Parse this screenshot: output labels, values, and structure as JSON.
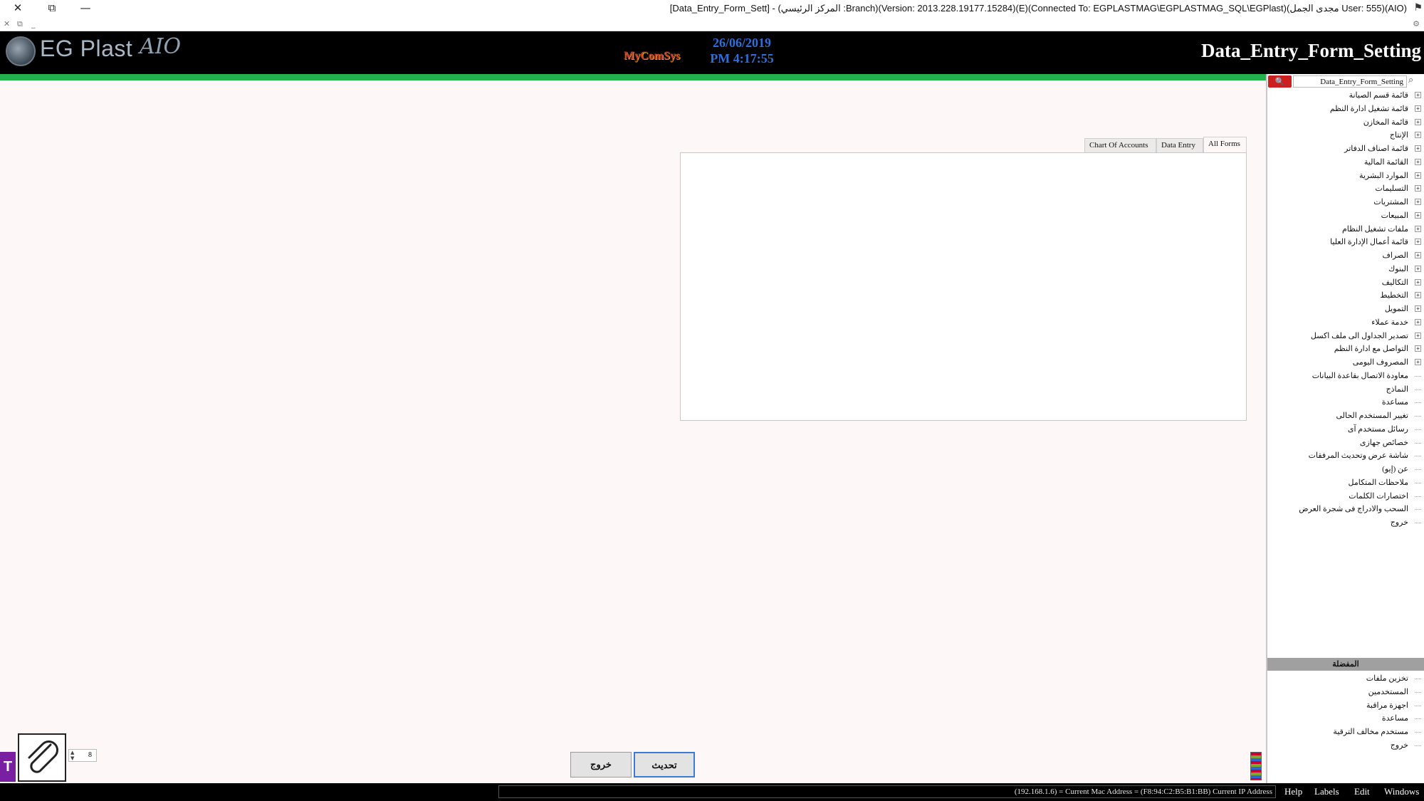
{
  "window": {
    "title": "[Data_Entry_Form_Sett] - (المركز الرئيسي :Branch)(Version: 2013.228.19177.15284)(E)(Connected To: EGPLASTMAG\\EGPLASTMAG_SQL\\EGPlast)(مجدى الجمل User: 555)(AIO)",
    "controls": {
      "close": "✕",
      "restore": "⧉",
      "minimize": "—"
    },
    "sub_controls": {
      "close": "✕",
      "restore": "⧉",
      "minimize": "_"
    }
  },
  "header": {
    "logo_text": "EG Plast",
    "logo_suffix": "AIO",
    "brand": "MyComSys",
    "date": "26/06/2019",
    "time": "PM 4:17:55",
    "form_title": "Data_Entry_Form_Setting"
  },
  "tabs": [
    {
      "label": "Chart Of Accounts"
    },
    {
      "label": "Data Entry"
    },
    {
      "label": "All Forms"
    }
  ],
  "sidebar": {
    "search_value": "Data_Entry_Form_Setting",
    "search_icon": "search-icon",
    "tree": [
      {
        "label": "قائمة قسم الصيانة",
        "expandable": true
      },
      {
        "label": "قائمة تشغيل ادارة النظم",
        "expandable": true
      },
      {
        "label": "قائمة المخازن",
        "expandable": true
      },
      {
        "label": "الإنتاج",
        "expandable": true
      },
      {
        "label": "قائمة اصناف الدفاتر",
        "expandable": true
      },
      {
        "label": "القائمة المالية",
        "expandable": true
      },
      {
        "label": "الموارد البشرية",
        "expandable": true
      },
      {
        "label": "التسليمات",
        "expandable": true
      },
      {
        "label": "المشتريات",
        "expandable": true
      },
      {
        "label": "المبيعات",
        "expandable": true
      },
      {
        "label": "ملفات تشغيل النظام",
        "expandable": true
      },
      {
        "label": "قائمة أعمال الإدارة العليا",
        "expandable": true
      },
      {
        "label": "الصراف",
        "expandable": true
      },
      {
        "label": "البنوك",
        "expandable": true
      },
      {
        "label": "التكاليف",
        "expandable": true
      },
      {
        "label": "التخطيط",
        "expandable": true
      },
      {
        "label": "التمويل",
        "expandable": true
      },
      {
        "label": "خدمة عملاء",
        "expandable": true
      },
      {
        "label": "تصدير الجداول الى ملف اكسل",
        "expandable": true
      },
      {
        "label": "التواصل مع ادارة النظم",
        "expandable": true
      },
      {
        "label": "المصروف اليومى",
        "expandable": true
      },
      {
        "label": "معاودة الاتصال بقاعدة البيانات",
        "expandable": false
      },
      {
        "label": "النماذج",
        "expandable": false
      },
      {
        "label": "مساعدة",
        "expandable": false
      },
      {
        "label": "تغيير المستخدم الحالى",
        "expandable": false
      },
      {
        "label": "رسائل مستخدم آى",
        "expandable": false
      },
      {
        "label": "خصائص جهازى",
        "expandable": false
      },
      {
        "label": "شاشة عرض وتحديث المرفقات",
        "expandable": false
      },
      {
        "label": "عن (إيو)",
        "expandable": false
      },
      {
        "label": "ملاحظات المتكامل",
        "expandable": false
      },
      {
        "label": "اختصارات الكلمات",
        "expandable": false
      },
      {
        "label": "السحب والادراج فى شجرة العرض",
        "expandable": false
      },
      {
        "label": "خروج",
        "expandable": false
      }
    ],
    "favorites_title": "المفضلة",
    "favorites": [
      {
        "label": "تخزين ملفات"
      },
      {
        "label": "المستخدمين"
      },
      {
        "label": "اجهزة مراقبة"
      },
      {
        "label": "مساعدة"
      },
      {
        "label": "مستخدم مخالف الترقية"
      },
      {
        "label": "خروج"
      }
    ]
  },
  "bottom": {
    "attachment_icon": "paperclip-icon",
    "spinner_value": "8",
    "left_badge": "T",
    "exit_button": "خروج",
    "update_button": "تحديث"
  },
  "statusbar": {
    "text": "(192.168.1.6) = Current Mac Address = (F8:94:C2:B5:B1:BB) Current IP Address",
    "menu": [
      "Help",
      "Labels",
      "Edit",
      "Windows"
    ]
  },
  "colors": {
    "header_bg": "#000000",
    "progress_green": "#22b14c",
    "date_blue": "#2e6fd8",
    "search_red": "#cc1f1f",
    "panel_bg": "#fdf7f7"
  }
}
